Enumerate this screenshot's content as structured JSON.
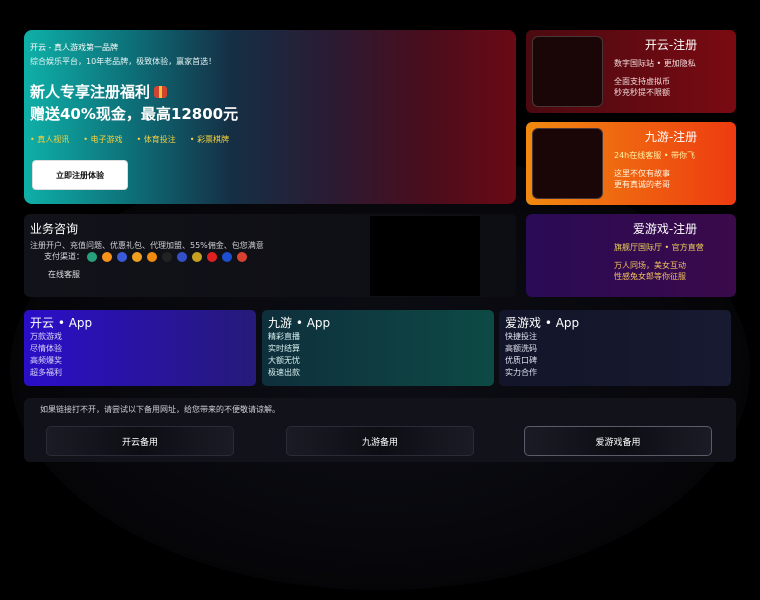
{
  "hero": {
    "brand": "开云 - 真人游戏第一品牌",
    "subtitle": "综合娱乐平台，10年老品牌，极致体验，赢家首选！",
    "headline1": "新人专享注册福利",
    "headline2": "赠送40%现金，最高12800元",
    "features": [
      "真人视讯",
      "电子游戏",
      "体育投注",
      "彩票棋牌"
    ],
    "cta_label": "立即注册体验"
  },
  "side_cards": [
    {
      "title": "开云-注册",
      "tag": "数字国际站 • 更加隐私",
      "line1": "全面支持虚拟币",
      "line2": "秒充秒提不限额"
    },
    {
      "title": "九游-注册",
      "tag": "24h在线客服 • 带你飞",
      "line1": "这里不仅有故事",
      "line2": "更有真诚的老哥"
    },
    {
      "title": "爱游戏-注册",
      "tag": "旗舰厅国际厅 • 官方直营",
      "line1": "万人同场，美女互动",
      "line2": "性感兔女郎等你征服"
    }
  ],
  "business": {
    "title": "业务咨询",
    "desc": "注册开户、充值问题、优惠礼包、代理加盟、55%佣金、包您满意",
    "pay_label": "支付渠道：",
    "service_label": "在线客服",
    "coin_colors": [
      "#27a17c",
      "#f7931a",
      "#3a5ad8",
      "#f0a020",
      "#f08a10",
      "#222",
      "#3350c8",
      "#c8a020",
      "#e02020",
      "#1d4fd0",
      "#d84030"
    ]
  },
  "apps": [
    {
      "title": "开云 • App",
      "items": [
        "万款游戏",
        "尽情体验",
        "高频爆奖",
        "超多福利"
      ]
    },
    {
      "title": "九游 • App",
      "items": [
        "精彩直播",
        "实时结算",
        "大额无忧",
        "极速出款"
      ]
    },
    {
      "title": "爱游戏 • App",
      "items": [
        "快捷投注",
        "高额洗码",
        "优质口碑",
        "实力合作"
      ]
    }
  ],
  "backup": {
    "note": "如果链接打不开，请尝试以下备用网址，给您带来的不便敬请谅解。",
    "links": [
      "开云备用",
      "九游备用",
      "爱游戏备用"
    ]
  }
}
